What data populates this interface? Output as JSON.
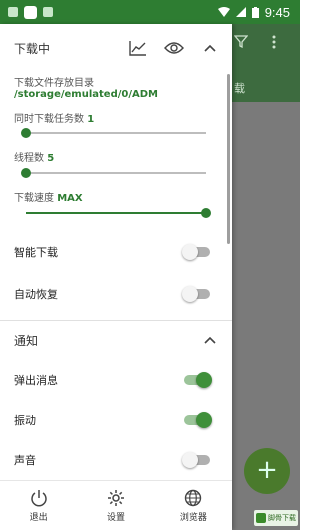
{
  "status_bar": {
    "time": "9:45"
  },
  "background": {
    "partial_tab_text": "载"
  },
  "download_section": {
    "title": "下载中",
    "storage_label": "下载文件存放目录",
    "storage_path": "/storage/emulated/0/ADM",
    "concurrent_label": "同时下载任务数",
    "concurrent_value": "1",
    "concurrent_level": 0.0,
    "threads_label": "线程数",
    "threads_value": "5",
    "threads_level": 0.0,
    "speed_label": "下载速度",
    "speed_value": "MAX",
    "speed_level": 1.0
  },
  "toggles_top": [
    {
      "label": "智能下载",
      "on": false
    },
    {
      "label": "自动恢复",
      "on": false
    }
  ],
  "notify_section": {
    "title": "通知"
  },
  "toggles_notify": [
    {
      "label": "弹出消息",
      "on": true
    },
    {
      "label": "振动",
      "on": true
    },
    {
      "label": "声音",
      "on": false
    }
  ],
  "bottom_nav": [
    {
      "label": "退出",
      "icon": "power-icon"
    },
    {
      "label": "设置",
      "icon": "gear-icon"
    },
    {
      "label": "浏览器",
      "icon": "globe-icon"
    }
  ],
  "watermark": {
    "text": "脚骨下载"
  },
  "colors": {
    "accent": "#2e7d32",
    "statusbar": "#2e7d32"
  }
}
